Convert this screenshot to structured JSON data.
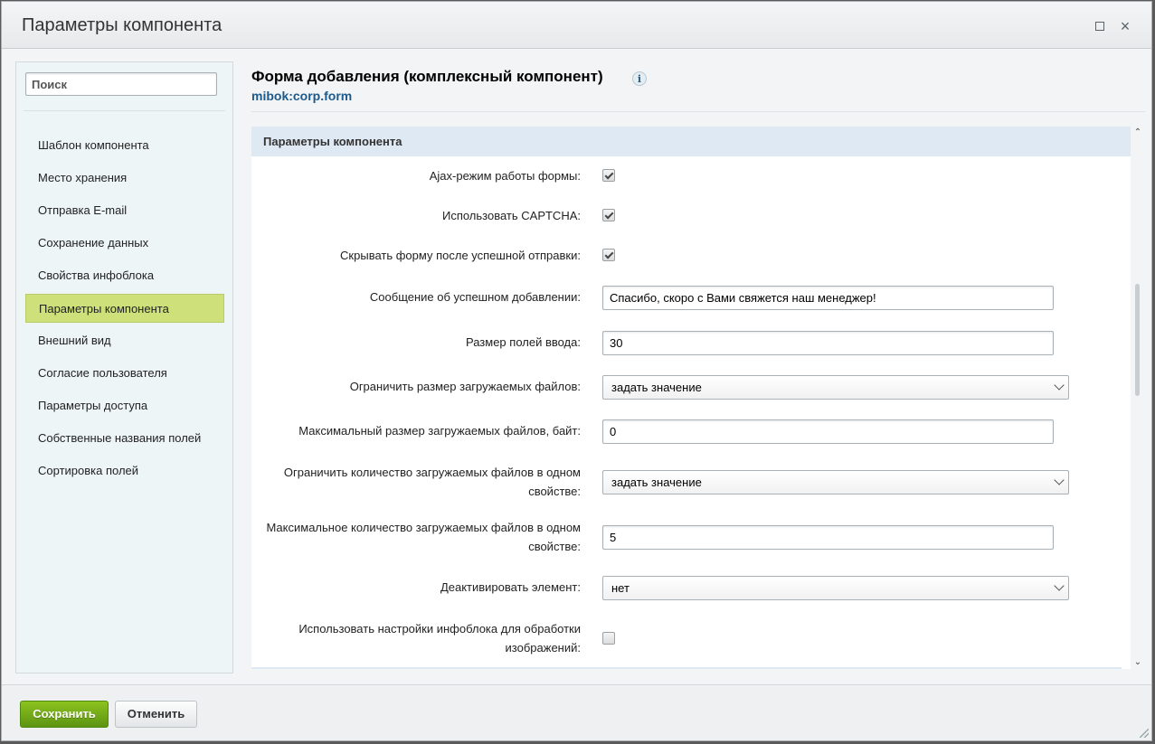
{
  "window": {
    "title": "Параметры компонента"
  },
  "sidebar": {
    "search_placeholder": "Поиск",
    "items": [
      {
        "label": "Шаблон компонента",
        "active": false
      },
      {
        "label": "Место хранения",
        "active": false
      },
      {
        "label": "Отправка E-mail",
        "active": false
      },
      {
        "label": "Сохранение данных",
        "active": false
      },
      {
        "label": "Свойства инфоблока",
        "active": false
      },
      {
        "label": "Параметры компонента",
        "active": true
      },
      {
        "label": "Внешний вид",
        "active": false
      },
      {
        "label": "Согласие пользователя",
        "active": false
      },
      {
        "label": "Параметры доступа",
        "active": false
      },
      {
        "label": "Собственные названия полей",
        "active": false
      },
      {
        "label": "Сортировка полей",
        "active": false
      }
    ]
  },
  "component": {
    "title": "Форма добавления (комплексный компонент)",
    "code": "mibok:corp.form",
    "info_icon": "i"
  },
  "section": {
    "header": "Параметры компонента",
    "fields": {
      "ajax": {
        "label": "Ajax-режим работы формы:",
        "checked": true
      },
      "captcha": {
        "label": "Использовать CAPTCHA:",
        "checked": true
      },
      "hide_form": {
        "label": "Скрывать форму после успешной отправки:",
        "checked": true
      },
      "success_msg": {
        "label": "Сообщение об успешном добавлении:",
        "value": "Спасибо, скоро с Вами свяжется наш менеджер!"
      },
      "input_size": {
        "label": "Размер полей ввода:",
        "value": "30"
      },
      "limit_file_size": {
        "label": "Ограничить размер загружаемых файлов:",
        "value": "задать значение"
      },
      "max_file_size": {
        "label": "Максимальный размер загружаемых файлов, байт:",
        "value": "0"
      },
      "limit_file_count": {
        "label": "Ограничить количество загружаемых файлов в одном свойстве:",
        "value": "задать значение"
      },
      "max_file_count": {
        "label": "Максимальное количество загружаемых файлов в одном свойстве:",
        "value": "5"
      },
      "deactivate": {
        "label": "Деактивировать элемент:",
        "value": "нет"
      },
      "iblock_images": {
        "label": "Использовать настройки инфоблока для обработки изображений:",
        "checked": false
      }
    }
  },
  "footer": {
    "save_label": "Сохранить",
    "cancel_label": "Отменить"
  },
  "icons": {
    "close": "×",
    "scroll_up": "⌃",
    "scroll_down": "⌄"
  }
}
